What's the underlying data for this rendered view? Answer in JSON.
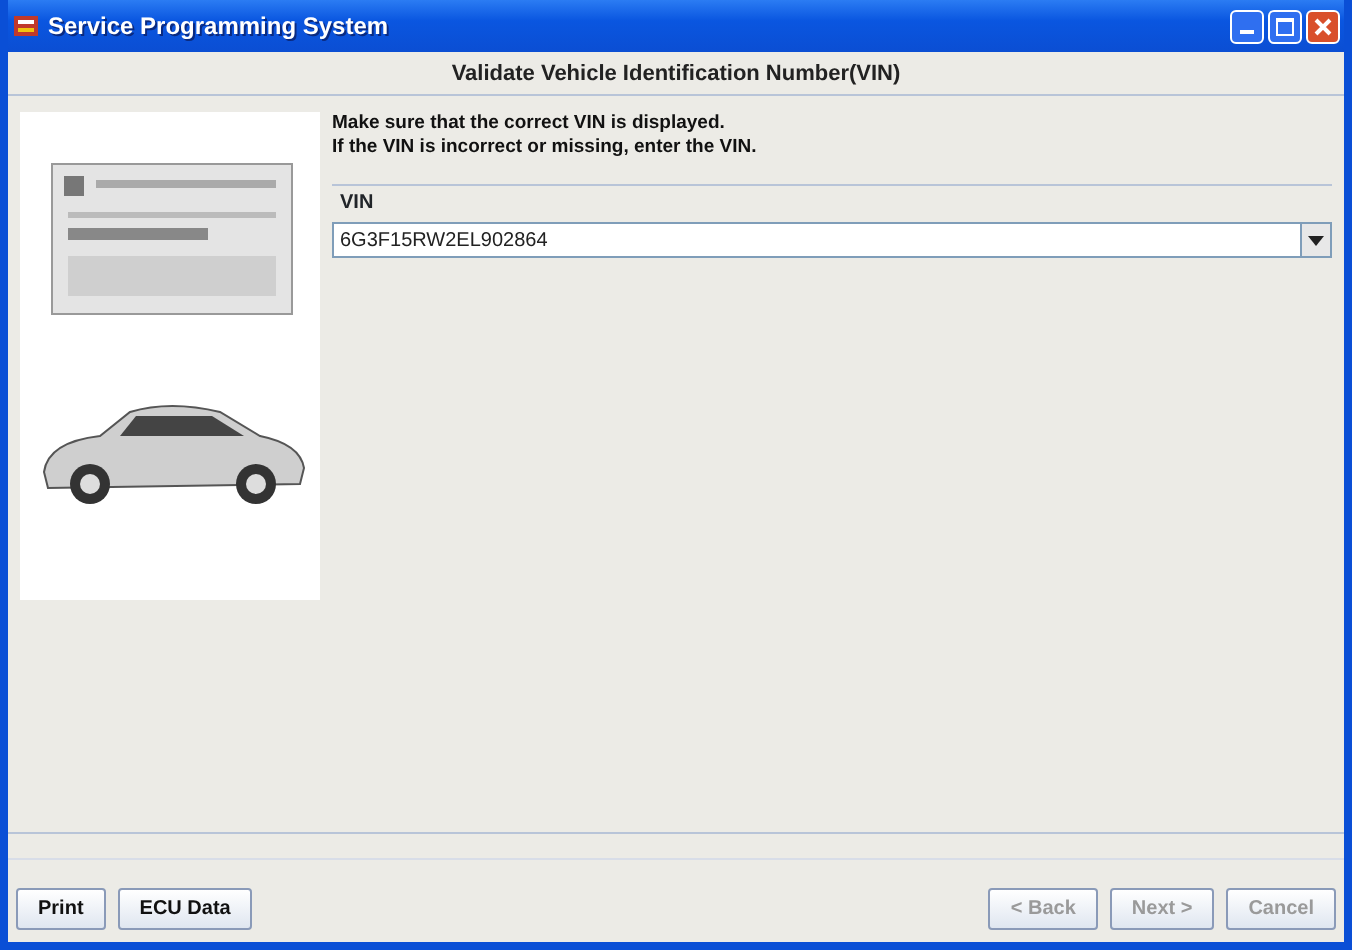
{
  "window": {
    "title": "Service Programming System"
  },
  "header": {
    "title": "Validate Vehicle Identification Number(VIN)"
  },
  "illustration": {
    "kind": "picture"
  },
  "instructions": [
    "Make sure that the correct VIN is displayed.",
    "If the VIN is incorrect or missing, enter the VIN."
  ],
  "vin": {
    "legend": "VIN",
    "value": "6G3F15RW2EL902864"
  },
  "left_buttons": [
    {
      "label": "Print",
      "disabled": false
    },
    {
      "label": "ECU Data",
      "disabled": false
    }
  ],
  "nav_buttons": [
    {
      "label": "< Back",
      "disabled": true
    },
    {
      "label": "Next >",
      "disabled": true
    },
    {
      "label": "Cancel",
      "disabled": true
    }
  ]
}
